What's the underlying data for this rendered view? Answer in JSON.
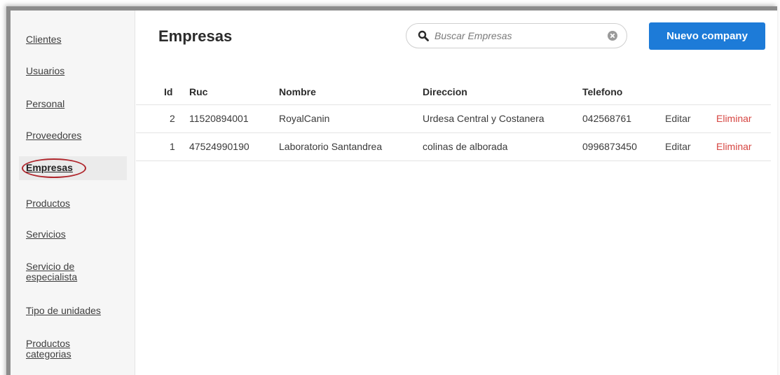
{
  "sidebar": {
    "items": [
      {
        "label": "Clientes"
      },
      {
        "label": "Usuarios"
      },
      {
        "label": "Personal"
      },
      {
        "label": "Proveedores"
      },
      {
        "label": "Empresas",
        "active": true
      },
      {
        "label": "Productos"
      },
      {
        "label": "Servicios"
      },
      {
        "label": "Servicio de especialista"
      },
      {
        "label": "Tipo de unidades"
      },
      {
        "label": "Productos categorias"
      }
    ]
  },
  "header": {
    "title": "Empresas",
    "search_placeholder": "Buscar Empresas",
    "new_button_label": "Nuevo company"
  },
  "table": {
    "columns": [
      "Id",
      "Ruc",
      "Nombre",
      "Direccion",
      "Telefono"
    ],
    "rows": [
      {
        "id": "2",
        "ruc": "11520894001",
        "nombre": "RoyalCanin",
        "direccion": "Urdesa Central y Costanera",
        "telefono": "042568761",
        "edit": "Editar",
        "delete": "Eliminar"
      },
      {
        "id": "1",
        "ruc": "47524990190",
        "nombre": "Laboratorio Santandrea",
        "direccion": "colinas de alborada",
        "telefono": "0996873450",
        "edit": "Editar",
        "delete": "Eliminar"
      }
    ]
  },
  "colors": {
    "primary_button": "#1d7bd8",
    "delete_link": "#d64541",
    "highlight_oval": "#b0272d"
  }
}
